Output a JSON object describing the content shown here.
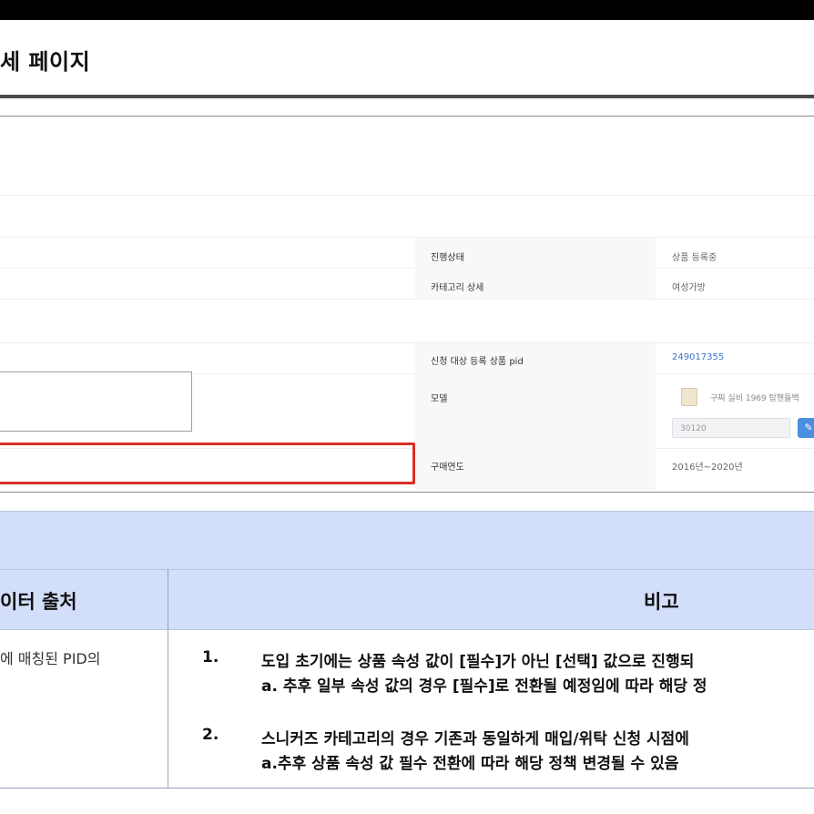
{
  "page": {
    "title": "세 페이지"
  },
  "detail_panel": {
    "rows": [
      {
        "label": "진행상태",
        "value": "상품 등록중"
      },
      {
        "label": "카테고리 상세",
        "value": "여성가방"
      },
      {
        "label": "신청 대상 등록 상품 pid",
        "value": "249017355"
      },
      {
        "label": "모델",
        "model_name": "구찌 실비 1969 탑핸들백",
        "pid_placeholder": "30120"
      },
      {
        "label": "구매연도",
        "value": "2016년~2020년"
      }
    ],
    "edit_icon": "pencil-icon"
  },
  "table": {
    "headers": {
      "source": "이터 출처",
      "note": "비고"
    },
    "left_cell": "에 매칭된 PID의",
    "notes": [
      {
        "num": "1.",
        "line1": "도입 초기에는 상품 속성 값이 [필수]가 아닌 [선택] 값으로 진행되",
        "line2": "a. 추후 일부 속성 값의 경우 [필수]로 전환될 예정임에 따라 해당 정"
      },
      {
        "num": "2.",
        "line1": "스니커즈 카테고리의 경우 기존과 동일하게 매입/위탁 신청 시점에",
        "line2": "a.추후 상품 속성 값 필수 전환에 따라 해당 정책 변경될 수 있음"
      }
    ]
  },
  "colors": {
    "header_bg": "#d3defa",
    "highlight": "#d93025",
    "link": "#3a73c9"
  }
}
